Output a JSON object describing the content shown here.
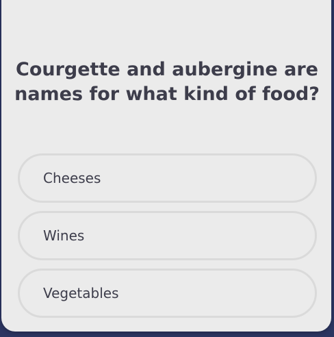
{
  "quiz": {
    "question": "Courgette and aubergine are names for what kind of food?",
    "answers": [
      {
        "label": "Cheeses"
      },
      {
        "label": "Wines"
      },
      {
        "label": "Vegetables"
      }
    ]
  },
  "colors": {
    "background": "#2c3561",
    "card": "#ebebeb",
    "text": "#3d3d4b",
    "option_border": "#dadada"
  },
  "icons": {
    "avatar": "avatar-icon"
  }
}
